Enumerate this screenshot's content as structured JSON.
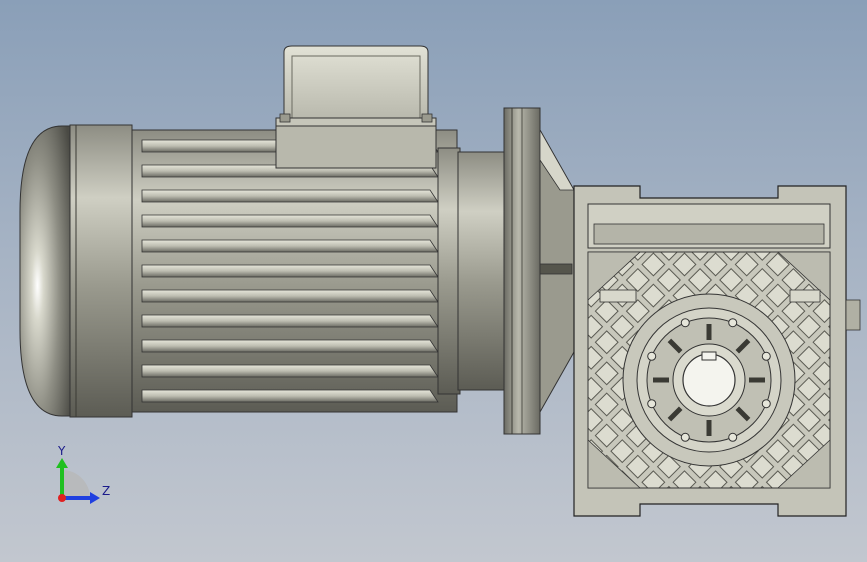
{
  "viewport": {
    "model": "worm-gear-motor-assembly"
  },
  "triad": {
    "x_label": "",
    "y_label": "Y",
    "z_label": "Z"
  },
  "colors": {
    "background_top": "#8a9fb8",
    "background_bottom": "#c2c7cf",
    "metal_light": "#d8d8cc",
    "metal_mid": "#a8a89c",
    "metal_dark": "#55554c",
    "axis_x": "#e02020",
    "axis_y": "#20c020",
    "axis_z": "#2040e0"
  }
}
